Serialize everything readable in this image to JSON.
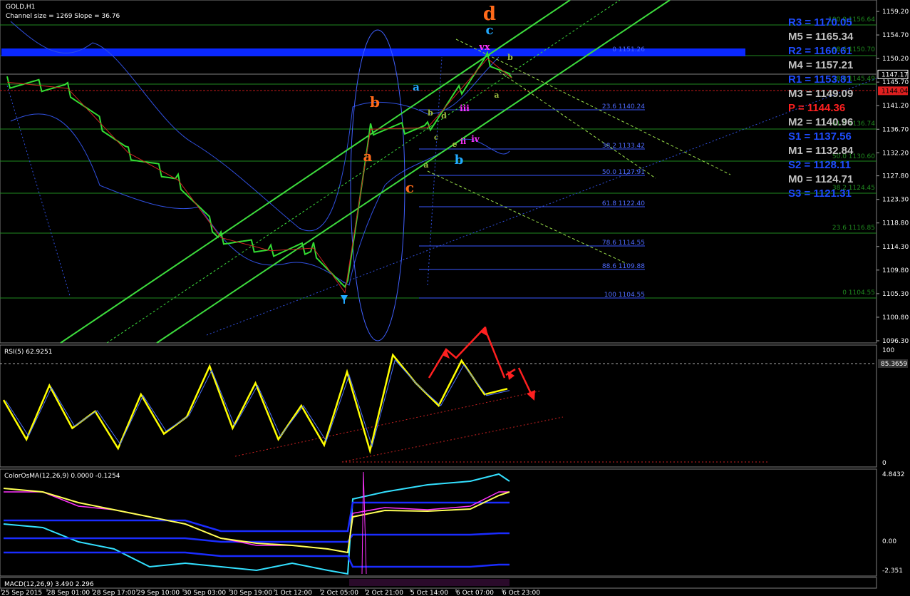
{
  "main": {
    "title": "GOLD,H1",
    "subtitle": "Channel size = 1269 Slope = 36.76",
    "price_ticks": [
      "1159.20",
      "1154.70",
      "1150.20",
      "1145.70",
      "1141.20",
      "1136.70",
      "1132.20",
      "1127.80",
      "1123.30",
      "1118.80",
      "1114.30",
      "1109.80",
      "1105.30",
      "1100.80",
      "1096.30"
    ],
    "current_price": "1147.17",
    "red_price": "1144.04",
    "pivots": [
      {
        "label": "R3 = 1170.05",
        "color": "#1e4cff"
      },
      {
        "label": "M5 = 1165.34",
        "color": "#c0c0c0"
      },
      {
        "label": "R2 = 1160.61",
        "color": "#1e4cff"
      },
      {
        "label": "M4 = 1157.21",
        "color": "#c0c0c0"
      },
      {
        "label": "R1 = 1153.81",
        "color": "#1e4cff"
      },
      {
        "label": "M3 = 1149.09",
        "color": "#c0c0c0"
      },
      {
        "label": "P = 1144.36",
        "color": "#ff2020"
      },
      {
        "label": "M2 = 1140.96",
        "color": "#c0c0c0"
      },
      {
        "label": "S1 = 1137.56",
        "color": "#1e4cff"
      },
      {
        "label": "M1 = 1132.84",
        "color": "#c0c0c0"
      },
      {
        "label": "S2 = 1128.11",
        "color": "#1e4cff"
      },
      {
        "label": "M0 = 1124.71",
        "color": "#c0c0c0"
      },
      {
        "label": "S3 = 1121.31",
        "color": "#1e4cff"
      }
    ],
    "fib_labels": [
      "0 1151.26",
      "23.6 1140.24",
      "38.2 1133.42",
      "50.0 1127.91",
      "61.8 1122.40",
      "78.6 1114.55",
      "88.6 1109.88",
      "100 1104.55"
    ],
    "fib_right_labels": [
      "100.0 1156.64",
      "88.6 1150.70",
      "78.6 1145.49",
      "61.8 1136.74",
      "50.0 1130.60",
      "38.2 1124.45",
      "23.6 1116.85",
      "0 1104.55"
    ],
    "wave_labels": [
      {
        "text": "d",
        "color": "#ff6a1a"
      },
      {
        "text": "c",
        "color": "#22aaff"
      },
      {
        "text": "vx",
        "color": "#ff33ff"
      },
      {
        "text": "b",
        "color": "#a0c040"
      },
      {
        "text": "a",
        "color": "#a0c040"
      },
      {
        "text": "a",
        "color": "#22aaff"
      },
      {
        "text": "b",
        "color": "#ff6a1a"
      },
      {
        "text": "a",
        "color": "#ff6a1a"
      },
      {
        "text": "c",
        "color": "#ff6a1a"
      },
      {
        "text": "b",
        "color": "#22aaff"
      },
      {
        "text": "iii",
        "color": "#ff33ff"
      },
      {
        "text": "iv",
        "color": "#ff33ff"
      },
      {
        "text": "ii",
        "color": "#ff33ff"
      },
      {
        "text": "b",
        "color": "#a0c040"
      },
      {
        "text": "d",
        "color": "#a0c040"
      },
      {
        "text": "c",
        "color": "#a0c040"
      },
      {
        "text": "e",
        "color": "#a0c040"
      },
      {
        "text": "a",
        "color": "#a0c040"
      }
    ]
  },
  "rsi_panel": {
    "title": "RSI(5) 62.9251",
    "tick_top": "100",
    "tick_bottom": "0",
    "level_value": "85.3659"
  },
  "osma_panel": {
    "title": "ColorOsMA(12,26,9) 0.0000 -0.1254",
    "ticks": [
      "4.8432",
      "0.00",
      "-2.351"
    ],
    "macd_title": "MACD(12,26,9) 3.490 2.296"
  },
  "time_axis": [
    "25 Sep 2015",
    "28 Sep 01:00",
    "28 Sep 17:00",
    "29 Sep 10:00",
    "30 Sep 03:00",
    "30 Sep 19:00",
    "1 Oct 12:00",
    "2 Oct 05:00",
    "2 Oct 21:00",
    "5 Oct 14:00",
    "6 Oct 07:00",
    "6 Oct 23:00"
  ],
  "colors": {
    "background": "#000000",
    "grid_green": "#1f8a1f",
    "channel": "#3ddc3d",
    "bands": "#2f4fd8",
    "rsi": "#ffff00",
    "arrows": "#ff2020",
    "resistance_bar": "#0a28ff"
  },
  "chart_data": [
    {
      "type": "line",
      "title": "GOLD,H1",
      "x": [
        "25 Sep 2015",
        "28 Sep 01:00",
        "28 Sep 17:00",
        "29 Sep 10:00",
        "30 Sep 03:00",
        "30 Sep 19:00",
        "1 Oct 12:00",
        "2 Oct 05:00",
        "2 Oct 21:00",
        "5 Oct 14:00",
        "6 Oct 07:00",
        "6 Oct 23:00"
      ],
      "series": [
        {
          "name": "GOLD,H1",
          "values": [
            1145.7,
            1144.5,
            1132.2,
            1127.0,
            1116.0,
            1113.5,
            1114.0,
            1105.5,
            1136.7,
            1137.0,
            1150.2,
            1146.5
          ]
        }
      ],
      "ylim": [
        1096.3,
        1159.2
      ]
    },
    {
      "type": "line",
      "title": "RSI(5) 62.9251",
      "series": [
        {
          "name": "RSI(5)",
          "values": [
            55,
            20,
            68,
            30,
            45,
            12,
            60,
            25,
            40,
            85,
            30,
            70,
            20,
            50,
            15,
            80,
            10,
            95,
            70,
            50,
            90,
            60,
            65
          ]
        }
      ],
      "ylim": [
        0,
        100
      ]
    },
    {
      "type": "line",
      "title": "ColorOsMA(12,26,9) 0.0000 -0.1254",
      "ylim": [
        -2.351,
        4.8432
      ]
    }
  ]
}
